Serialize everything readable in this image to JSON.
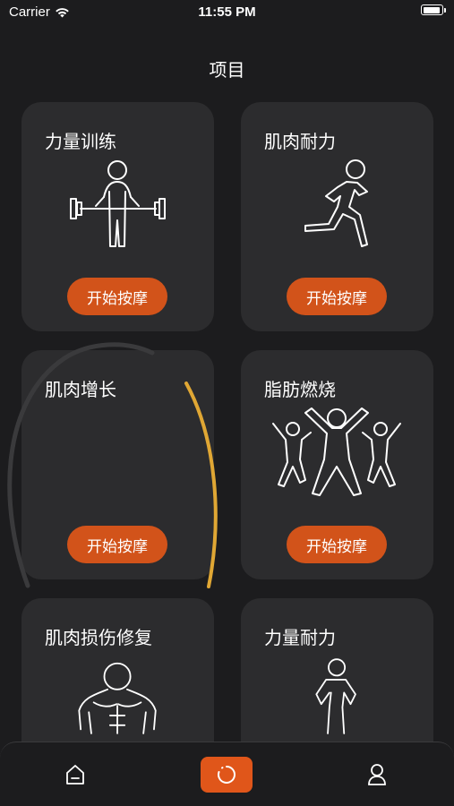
{
  "status_bar": {
    "carrier": "Carrier",
    "time": "11:55 PM"
  },
  "page": {
    "title": "项目"
  },
  "cards": [
    {
      "title": "力量训练",
      "button": "开始按摩",
      "icon": "weightlifter-icon"
    },
    {
      "title": "肌肉耐力",
      "button": "开始按摩",
      "icon": "runner-icon"
    },
    {
      "title": "肌肉增长",
      "button": "开始按摩",
      "icon": "loading-arc"
    },
    {
      "title": "脂肪燃烧",
      "button": "开始按摩",
      "icon": "jumping-people-icon"
    },
    {
      "title": "肌肉损伤修复",
      "button": "",
      "icon": "muscle-torso-icon"
    },
    {
      "title": "力量耐力",
      "button": "",
      "icon": "standing-person-icon"
    }
  ],
  "tab_bar": {
    "items": [
      {
        "name": "home",
        "icon": "home-icon"
      },
      {
        "name": "projects",
        "icon": "circle-refresh-icon",
        "active": true
      },
      {
        "name": "profile",
        "icon": "person-icon"
      }
    ]
  },
  "colors": {
    "background": "#1c1c1e",
    "card": "#2c2c2e",
    "accent": "#d2531a",
    "arc": "#e0a734"
  }
}
